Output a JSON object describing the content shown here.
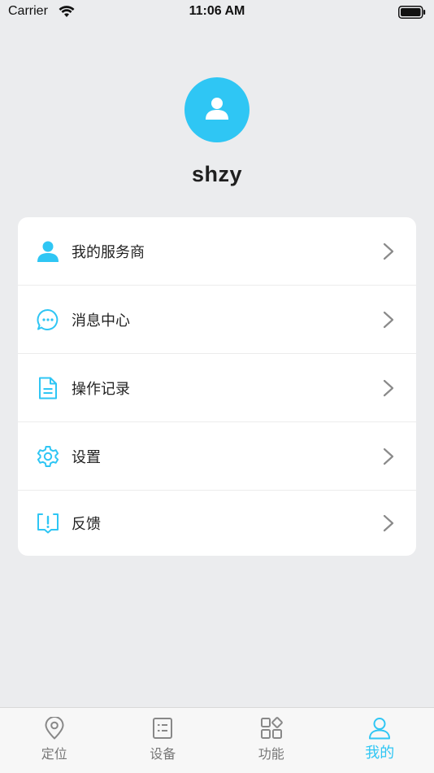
{
  "status_bar": {
    "carrier": "Carrier",
    "time": "11:06 AM"
  },
  "profile": {
    "username": "shzy",
    "avatar_icon": "user-icon",
    "avatar_color": "#2fc6f4"
  },
  "menu": {
    "items": [
      {
        "label": "我的服务商",
        "icon": "person-icon"
      },
      {
        "label": "消息中心",
        "icon": "chat-bubble-icon"
      },
      {
        "label": "操作记录",
        "icon": "document-icon"
      },
      {
        "label": "设置",
        "icon": "gear-icon"
      },
      {
        "label": "反馈",
        "icon": "feedback-icon"
      }
    ]
  },
  "tabs": {
    "items": [
      {
        "label": "定位",
        "icon": "location-pin-icon",
        "active": false
      },
      {
        "label": "设备",
        "icon": "device-list-icon",
        "active": false
      },
      {
        "label": "功能",
        "icon": "apps-grid-icon",
        "active": false
      },
      {
        "label": "我的",
        "icon": "profile-icon",
        "active": true
      }
    ]
  },
  "colors": {
    "accent": "#2fc6f4",
    "inactive": "#777777",
    "background": "#ebecee"
  }
}
